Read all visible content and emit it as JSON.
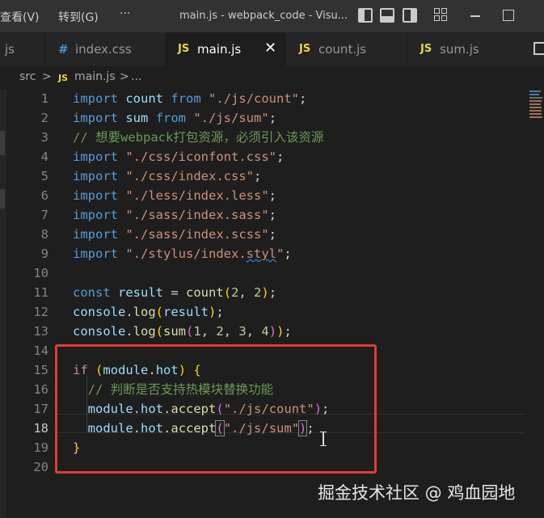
{
  "titlebar": {
    "menu_view": "查看(V)",
    "menu_goto": "转到(G)",
    "more": "···",
    "title": "main.js - webpack_code - Visu..."
  },
  "tabs": [
    {
      "icon": "",
      "label": "js",
      "active": false
    },
    {
      "icon": "#",
      "label": "index.css",
      "active": false
    },
    {
      "icon": "JS",
      "label": "main.js",
      "active": true,
      "close": "✕"
    },
    {
      "icon": "JS",
      "label": "count.js",
      "active": false
    },
    {
      "icon": "JS",
      "label": "sum.js",
      "active": false
    }
  ],
  "breadcrumb": {
    "folder": "src",
    "sep": ">",
    "file": "main.js",
    "sep2": ">",
    "more": "..."
  },
  "editor": {
    "current_line": 18,
    "lines": [
      {
        "n": "1",
        "t": [
          [
            "kw",
            "import"
          ],
          [
            "pn",
            " "
          ],
          [
            "var",
            "count"
          ],
          [
            "pn",
            " "
          ],
          [
            "kw",
            "from"
          ],
          [
            "pn",
            " "
          ],
          [
            "str",
            "\"./js/count\""
          ],
          [
            "pn",
            ";"
          ]
        ]
      },
      {
        "n": "2",
        "t": [
          [
            "kw",
            "import"
          ],
          [
            "pn",
            " "
          ],
          [
            "var",
            "sum"
          ],
          [
            "pn",
            " "
          ],
          [
            "kw",
            "from"
          ],
          [
            "pn",
            " "
          ],
          [
            "str",
            "\"./js/sum\""
          ],
          [
            "pn",
            ";"
          ]
        ]
      },
      {
        "n": "3",
        "t": [
          [
            "cmt",
            "// 想要webpack打包资源，必须引入该资源"
          ]
        ]
      },
      {
        "n": "4",
        "t": [
          [
            "kw",
            "import"
          ],
          [
            "pn",
            " "
          ],
          [
            "str",
            "\"./css/iconfont.css\""
          ],
          [
            "pn",
            ";"
          ]
        ]
      },
      {
        "n": "5",
        "t": [
          [
            "kw",
            "import"
          ],
          [
            "pn",
            " "
          ],
          [
            "str",
            "\"./css/index.css\""
          ],
          [
            "pn",
            ";"
          ]
        ]
      },
      {
        "n": "6",
        "t": [
          [
            "kw",
            "import"
          ],
          [
            "pn",
            " "
          ],
          [
            "str",
            "\"./less/index.less\""
          ],
          [
            "pn",
            ";"
          ]
        ]
      },
      {
        "n": "7",
        "t": [
          [
            "kw",
            "import"
          ],
          [
            "pn",
            " "
          ],
          [
            "str",
            "\"./sass/index.sass\""
          ],
          [
            "pn",
            ";"
          ]
        ]
      },
      {
        "n": "8",
        "t": [
          [
            "kw",
            "import"
          ],
          [
            "pn",
            " "
          ],
          [
            "str",
            "\"./sass/index.scss\""
          ],
          [
            "pn",
            ";"
          ]
        ]
      },
      {
        "n": "9",
        "t": [
          [
            "kw",
            "import"
          ],
          [
            "pn",
            " "
          ],
          [
            "str",
            "\"./stylus/index."
          ],
          [
            "str squiggle",
            "styl"
          ],
          [
            "str",
            "\""
          ],
          [
            "pn",
            ";"
          ]
        ]
      },
      {
        "n": "10",
        "t": []
      },
      {
        "n": "11",
        "t": [
          [
            "kw",
            "const"
          ],
          [
            "pn",
            " "
          ],
          [
            "var",
            "result"
          ],
          [
            "pn",
            " = "
          ],
          [
            "fn",
            "count"
          ],
          [
            "br1",
            "("
          ],
          [
            "num",
            "2"
          ],
          [
            "pn",
            ", "
          ],
          [
            "num",
            "2"
          ],
          [
            "br1",
            ")"
          ],
          [
            "pn",
            ";"
          ]
        ]
      },
      {
        "n": "12",
        "t": [
          [
            "var",
            "console"
          ],
          [
            "pn",
            "."
          ],
          [
            "fn",
            "log"
          ],
          [
            "br1",
            "("
          ],
          [
            "var",
            "result"
          ],
          [
            "br1",
            ")"
          ],
          [
            "pn",
            ";"
          ]
        ]
      },
      {
        "n": "13",
        "t": [
          [
            "var",
            "console"
          ],
          [
            "pn",
            "."
          ],
          [
            "fn",
            "log"
          ],
          [
            "br1",
            "("
          ],
          [
            "fn",
            "sum"
          ],
          [
            "br2",
            "("
          ],
          [
            "num",
            "1"
          ],
          [
            "pn",
            ", "
          ],
          [
            "num",
            "2"
          ],
          [
            "pn",
            ", "
          ],
          [
            "num",
            "3"
          ],
          [
            "pn",
            ", "
          ],
          [
            "num",
            "4"
          ],
          [
            "br2",
            ")"
          ],
          [
            "br1",
            ")"
          ],
          [
            "pn",
            ";"
          ]
        ]
      },
      {
        "n": "14",
        "t": []
      },
      {
        "n": "15",
        "t": [
          [
            "ctl",
            "if"
          ],
          [
            "pn",
            " "
          ],
          [
            "br1",
            "("
          ],
          [
            "var",
            "module"
          ],
          [
            "pn",
            "."
          ],
          [
            "var",
            "hot"
          ],
          [
            "br1",
            ")"
          ],
          [
            "pn",
            " "
          ],
          [
            "br1",
            "{"
          ]
        ]
      },
      {
        "n": "16",
        "t": [
          [
            "pn",
            "  "
          ],
          [
            "cmt",
            "// 判断是否支持热模块替换功能"
          ]
        ]
      },
      {
        "n": "17",
        "t": [
          [
            "pn",
            "  "
          ],
          [
            "var",
            "module"
          ],
          [
            "pn",
            "."
          ],
          [
            "var",
            "hot"
          ],
          [
            "pn",
            "."
          ],
          [
            "fn",
            "accept"
          ],
          [
            "br2",
            "("
          ],
          [
            "str",
            "\"./js/count\""
          ],
          [
            "br2",
            ")"
          ],
          [
            "pn",
            ";"
          ]
        ]
      },
      {
        "n": "18",
        "t": [
          [
            "pn",
            "  "
          ],
          [
            "var",
            "module"
          ],
          [
            "pn",
            "."
          ],
          [
            "var",
            "hot"
          ],
          [
            "pn",
            "."
          ],
          [
            "fn",
            "accept"
          ],
          [
            "br2 match-box",
            "("
          ],
          [
            "str",
            "\"./js/sum\""
          ],
          [
            "br2 match-box",
            ")"
          ],
          [
            "pn",
            ";"
          ]
        ]
      },
      {
        "n": "19",
        "t": [
          [
            "br1",
            "}"
          ]
        ]
      },
      {
        "n": "20",
        "t": []
      }
    ]
  },
  "watermark": "掘金技术社区 @ 鸡血园地",
  "colors": {
    "background": "#1e1e1e",
    "keyword": "#569cd6",
    "string": "#ce9178",
    "comment": "#6a9955",
    "highlight_rect": "#e53935"
  }
}
